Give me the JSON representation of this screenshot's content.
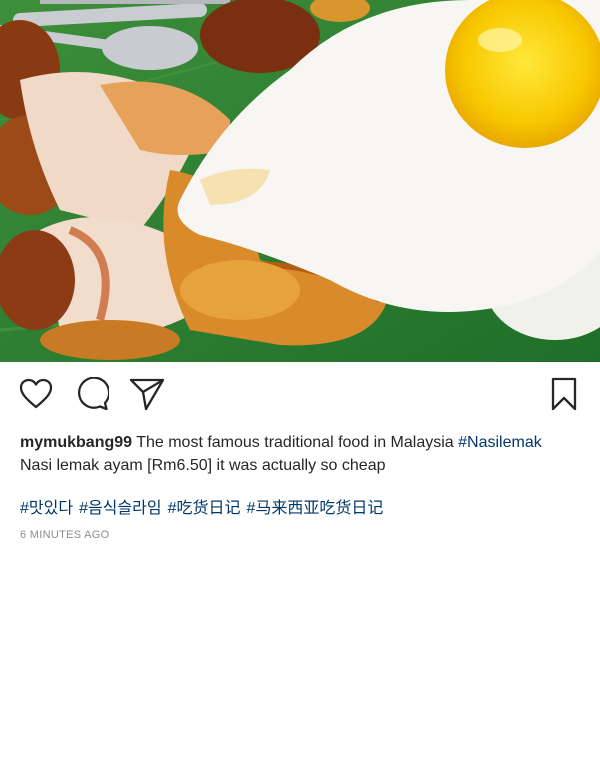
{
  "post": {
    "username": "mymukbang99",
    "caption_text": "The most famous traditional food in Malaysia",
    "caption_hashtag": "#Nasilemak",
    "caption_line2": "Nasi lemak ayam [Rm6.50] it was actually so cheap",
    "hashtags": [
      "#맛있다",
      "#음식슬라임",
      "#吃货日记",
      "#马来西亚吃货日记"
    ],
    "timestamp": "6 MINUTES AGO"
  },
  "icons": {
    "like": "heart-icon",
    "comment": "comment-icon",
    "share": "paper-plane-icon",
    "save": "bookmark-icon"
  },
  "colors": {
    "hashtag": "#00376b",
    "timestamp": "#8e8e8e",
    "text": "#262626"
  }
}
